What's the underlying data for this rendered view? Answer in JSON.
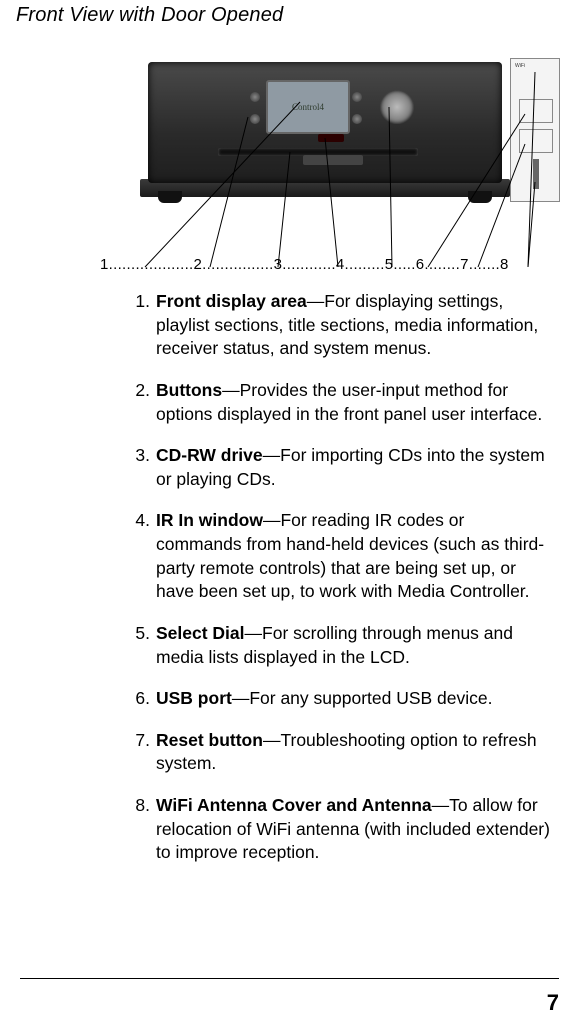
{
  "title": "Front View with Door Opened",
  "screen_label": "Control4",
  "opendoor_small_text": "WiFi",
  "ruler": "1...................2................3............4.........5.....6........7.......8",
  "items": [
    {
      "n": "1.",
      "term": "Front display area",
      "desc": "—For displaying settings, playlist sections, title sections, media information, receiver status, and system menus."
    },
    {
      "n": "2.",
      "term": "Buttons",
      "desc": "—Provides the user-input method for options displayed in the front panel user interface."
    },
    {
      "n": "3.",
      "term": "CD-RW drive",
      "desc": "—For importing CDs into the system or playing CDs."
    },
    {
      "n": "4.",
      "term": "IR In window",
      "desc": "—For reading IR codes or commands from hand-held devices (such as third-party remote controls) that are being set up, or have been set up, to work with Media Controller."
    },
    {
      "n": "5.",
      "term": "Select Dial",
      "desc": "—For scrolling through menus and media lists displayed in the LCD."
    },
    {
      "n": "6.",
      "term": "USB port",
      "desc": "—For any supported USB device."
    },
    {
      "n": "7.",
      "term": "Reset button",
      "desc": "—Troubleshooting option to refresh system."
    },
    {
      "n": "8.",
      "term": "WiFi Antenna Cover and Antenna",
      "desc": "—To allow for relocation of WiFi antenna (with included extender) to improve reception."
    }
  ],
  "page_number": "7"
}
